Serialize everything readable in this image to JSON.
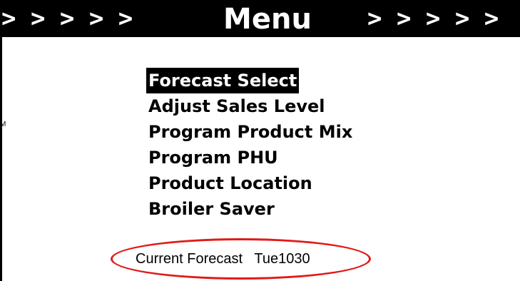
{
  "header": {
    "left_chevrons": "> > > > >",
    "title": "Menu",
    "right_chevrons": "> > > > >"
  },
  "side_mark": "M",
  "menu": {
    "items": [
      {
        "label": "Forecast Select",
        "selected": true
      },
      {
        "label": "Adjust Sales Level",
        "selected": false
      },
      {
        "label": "Program Product Mix",
        "selected": false
      },
      {
        "label": "Program PHU",
        "selected": false
      },
      {
        "label": "Product Location",
        "selected": false
      },
      {
        "label": "Broiler Saver",
        "selected": false
      }
    ]
  },
  "status": {
    "label": "Current Forecast",
    "value": "Tue1030"
  },
  "colors": {
    "header_bg": "#000000",
    "header_text": "#ffffff",
    "selection_bg": "#000000",
    "selection_text": "#ffffff",
    "highlight_oval": "#e11a1a"
  }
}
